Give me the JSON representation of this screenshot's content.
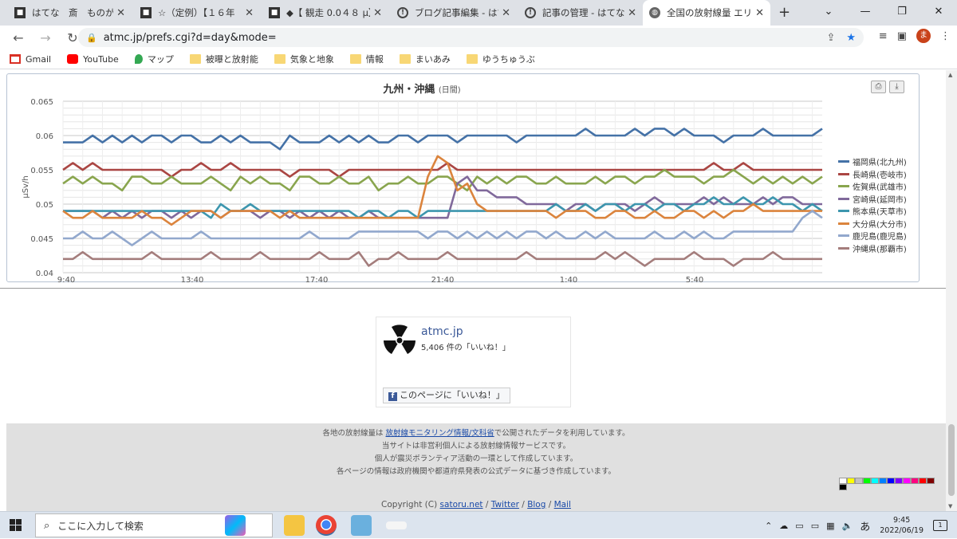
{
  "tabs": [
    {
      "label": "はてな　斎　ものが",
      "icon": "app-icon"
    },
    {
      "label": "☆（定例）【１６年",
      "icon": "app-icon"
    },
    {
      "label": "◆【 観走 0.0４８ μ】",
      "icon": "app-icon"
    },
    {
      "label": "ブログ記事編集 - はてな",
      "icon": "hatena-icon"
    },
    {
      "label": "記事の管理 - はてなブロ",
      "icon": "hatena-icon"
    },
    {
      "label": "全国の放射線量 エリア",
      "icon": "globe-icon"
    }
  ],
  "window_controls": {
    "minimize": "⌄",
    "min": "—",
    "restore": "❐",
    "close": "✕"
  },
  "address": {
    "url": "atmc.jp/prefs.cgi?d=day&mode=",
    "avatar_letter": "ま"
  },
  "bookmarks": [
    {
      "label": "Gmail",
      "icon": "gmail-icon"
    },
    {
      "label": "YouTube",
      "icon": "youtube-icon"
    },
    {
      "label": "マップ",
      "icon": "maps-icon"
    },
    {
      "label": "被曝と放射能",
      "icon": "folder-icon"
    },
    {
      "label": "気象と地象",
      "icon": "folder-icon"
    },
    {
      "label": "情報",
      "icon": "folder-icon"
    },
    {
      "label": "まいあみ",
      "icon": "folder-icon"
    },
    {
      "label": "ゆうちゅうぶ",
      "icon": "folder-icon"
    }
  ],
  "chart_data": {
    "type": "line",
    "title": "九州・沖縄",
    "subtitle": "(日間)",
    "ylabel": "μSv/h",
    "xlabel": "",
    "ylim": [
      0.04,
      0.065
    ],
    "yticks": [
      "0.065",
      "0.06",
      "0.055",
      "0.05",
      "0.045",
      "0.04"
    ],
    "xticks": [
      "9:40",
      "13:40",
      "17:40",
      "21:40",
      "1:40",
      "5:40"
    ],
    "grid": true,
    "legend_position": "right",
    "series": [
      {
        "name": "福岡県(北九州)",
        "color": "#4572a7",
        "values": [
          0.059,
          0.059,
          0.059,
          0.06,
          0.059,
          0.06,
          0.059,
          0.06,
          0.059,
          0.06,
          0.06,
          0.059,
          0.06,
          0.06,
          0.059,
          0.059,
          0.06,
          0.059,
          0.06,
          0.059,
          0.059,
          0.059,
          0.058,
          0.06,
          0.059,
          0.059,
          0.059,
          0.06,
          0.059,
          0.06,
          0.059,
          0.06,
          0.059,
          0.059,
          0.06,
          0.06,
          0.059,
          0.06,
          0.06,
          0.06,
          0.059,
          0.06,
          0.06,
          0.06,
          0.06,
          0.06,
          0.059,
          0.06,
          0.06,
          0.06,
          0.06,
          0.06,
          0.06,
          0.061,
          0.06,
          0.06,
          0.06,
          0.06,
          0.061,
          0.06,
          0.061,
          0.061,
          0.06,
          0.061,
          0.06,
          0.06,
          0.06,
          0.059,
          0.06,
          0.06,
          0.06,
          0.061,
          0.06,
          0.06,
          0.06,
          0.06,
          0.06,
          0.061
        ]
      },
      {
        "name": "長崎県(壱岐市)",
        "color": "#aa4643",
        "values": [
          0.055,
          0.056,
          0.055,
          0.056,
          0.055,
          0.055,
          0.055,
          0.055,
          0.055,
          0.055,
          0.055,
          0.054,
          0.055,
          0.055,
          0.056,
          0.055,
          0.055,
          0.056,
          0.055,
          0.055,
          0.055,
          0.055,
          0.055,
          0.054,
          0.055,
          0.055,
          0.055,
          0.055,
          0.054,
          0.055,
          0.055,
          0.055,
          0.055,
          0.055,
          0.055,
          0.055,
          0.055,
          0.055,
          0.055,
          0.056,
          0.055,
          0.055,
          0.055,
          0.055,
          0.055,
          0.055,
          0.055,
          0.055,
          0.055,
          0.055,
          0.055,
          0.055,
          0.055,
          0.055,
          0.055,
          0.055,
          0.055,
          0.055,
          0.055,
          0.055,
          0.055,
          0.055,
          0.055,
          0.055,
          0.055,
          0.055,
          0.056,
          0.055,
          0.055,
          0.056,
          0.055,
          0.055,
          0.055,
          0.055,
          0.055,
          0.055,
          0.055,
          0.055
        ]
      },
      {
        "name": "佐賀県(武雄市)",
        "color": "#89a54e",
        "values": [
          0.053,
          0.054,
          0.053,
          0.054,
          0.053,
          0.053,
          0.052,
          0.054,
          0.054,
          0.053,
          0.053,
          0.054,
          0.053,
          0.053,
          0.053,
          0.054,
          0.053,
          0.052,
          0.054,
          0.053,
          0.054,
          0.053,
          0.053,
          0.052,
          0.054,
          0.054,
          0.053,
          0.053,
          0.054,
          0.053,
          0.053,
          0.054,
          0.052,
          0.053,
          0.053,
          0.054,
          0.053,
          0.053,
          0.054,
          0.054,
          0.053,
          0.052,
          0.054,
          0.053,
          0.054,
          0.053,
          0.054,
          0.054,
          0.053,
          0.053,
          0.054,
          0.053,
          0.053,
          0.053,
          0.054,
          0.053,
          0.054,
          0.054,
          0.053,
          0.054,
          0.054,
          0.055,
          0.054,
          0.054,
          0.054,
          0.053,
          0.054,
          0.054,
          0.055,
          0.054,
          0.053,
          0.054,
          0.053,
          0.054,
          0.053,
          0.054,
          0.053,
          0.054
        ]
      },
      {
        "name": "宮崎県(延岡市)",
        "color": "#80699b",
        "values": [
          0.049,
          0.049,
          0.049,
          0.049,
          0.048,
          0.049,
          0.048,
          0.049,
          0.048,
          0.049,
          0.049,
          0.048,
          0.049,
          0.048,
          0.049,
          0.049,
          0.048,
          0.049,
          0.049,
          0.049,
          0.048,
          0.049,
          0.049,
          0.048,
          0.049,
          0.048,
          0.049,
          0.048,
          0.049,
          0.048,
          0.048,
          0.049,
          0.048,
          0.048,
          0.048,
          0.048,
          0.048,
          0.048,
          0.048,
          0.048,
          0.053,
          0.054,
          0.052,
          0.052,
          0.051,
          0.051,
          0.051,
          0.05,
          0.05,
          0.05,
          0.05,
          0.049,
          0.05,
          0.05,
          0.049,
          0.05,
          0.05,
          0.05,
          0.049,
          0.05,
          0.051,
          0.05,
          0.05,
          0.05,
          0.05,
          0.051,
          0.05,
          0.051,
          0.05,
          0.05,
          0.05,
          0.051,
          0.05,
          0.051,
          0.051,
          0.05,
          0.05,
          0.05
        ]
      },
      {
        "name": "熊本県(天草市)",
        "color": "#3d96ae",
        "values": [
          0.049,
          0.049,
          0.049,
          0.049,
          0.049,
          0.049,
          0.049,
          0.049,
          0.049,
          0.049,
          0.049,
          0.049,
          0.049,
          0.049,
          0.049,
          0.048,
          0.05,
          0.049,
          0.049,
          0.05,
          0.049,
          0.049,
          0.049,
          0.049,
          0.049,
          0.049,
          0.049,
          0.049,
          0.049,
          0.049,
          0.048,
          0.049,
          0.049,
          0.048,
          0.049,
          0.049,
          0.048,
          0.049,
          0.049,
          0.049,
          0.049,
          0.049,
          0.049,
          0.049,
          0.049,
          0.049,
          0.049,
          0.049,
          0.049,
          0.049,
          0.05,
          0.049,
          0.049,
          0.05,
          0.049,
          0.05,
          0.05,
          0.049,
          0.05,
          0.05,
          0.049,
          0.05,
          0.05,
          0.049,
          0.05,
          0.05,
          0.051,
          0.05,
          0.05,
          0.051,
          0.05,
          0.05,
          0.051,
          0.05,
          0.05,
          0.049,
          0.05,
          0.049
        ]
      },
      {
        "name": "大分県(大分市)",
        "color": "#db843d",
        "values": [
          0.049,
          0.048,
          0.048,
          0.049,
          0.048,
          0.048,
          0.048,
          0.048,
          0.049,
          0.048,
          0.048,
          0.047,
          0.048,
          0.049,
          0.049,
          0.049,
          0.048,
          0.049,
          0.049,
          0.049,
          0.049,
          0.049,
          0.048,
          0.049,
          0.048,
          0.048,
          0.048,
          0.048,
          0.048,
          0.048,
          0.048,
          0.048,
          0.048,
          0.048,
          0.048,
          0.048,
          0.048,
          0.054,
          0.057,
          0.056,
          0.052,
          0.053,
          0.05,
          0.049,
          0.049,
          0.049,
          0.049,
          0.049,
          0.049,
          0.049,
          0.048,
          0.049,
          0.049,
          0.049,
          0.048,
          0.048,
          0.049,
          0.049,
          0.048,
          0.048,
          0.049,
          0.048,
          0.048,
          0.049,
          0.049,
          0.048,
          0.049,
          0.048,
          0.049,
          0.049,
          0.05,
          0.049,
          0.049,
          0.049,
          0.049,
          0.049,
          0.049,
          0.049
        ]
      },
      {
        "name": "鹿児島(鹿児島)",
        "color": "#92a8cd",
        "values": [
          0.045,
          0.045,
          0.046,
          0.045,
          0.045,
          0.046,
          0.045,
          0.044,
          0.045,
          0.046,
          0.045,
          0.045,
          0.045,
          0.045,
          0.046,
          0.045,
          0.045,
          0.045,
          0.045,
          0.045,
          0.045,
          0.045,
          0.045,
          0.045,
          0.045,
          0.046,
          0.045,
          0.045,
          0.045,
          0.045,
          0.046,
          0.046,
          0.046,
          0.046,
          0.046,
          0.046,
          0.046,
          0.045,
          0.046,
          0.046,
          0.045,
          0.046,
          0.045,
          0.046,
          0.045,
          0.046,
          0.045,
          0.046,
          0.046,
          0.045,
          0.046,
          0.045,
          0.045,
          0.046,
          0.045,
          0.046,
          0.045,
          0.045,
          0.045,
          0.045,
          0.046,
          0.045,
          0.045,
          0.046,
          0.045,
          0.046,
          0.045,
          0.045,
          0.046,
          0.046,
          0.046,
          0.046,
          0.046,
          0.046,
          0.046,
          0.048,
          0.049,
          0.048
        ]
      },
      {
        "name": "沖縄県(那覇市)",
        "color": "#a47d7c",
        "values": [
          0.042,
          0.042,
          0.043,
          0.042,
          0.042,
          0.042,
          0.042,
          0.042,
          0.042,
          0.043,
          0.042,
          0.042,
          0.042,
          0.042,
          0.042,
          0.043,
          0.042,
          0.042,
          0.042,
          0.042,
          0.043,
          0.042,
          0.042,
          0.042,
          0.042,
          0.042,
          0.043,
          0.042,
          0.042,
          0.042,
          0.043,
          0.041,
          0.042,
          0.042,
          0.043,
          0.042,
          0.042,
          0.042,
          0.042,
          0.043,
          0.042,
          0.042,
          0.042,
          0.042,
          0.042,
          0.042,
          0.042,
          0.043,
          0.042,
          0.042,
          0.042,
          0.042,
          0.042,
          0.042,
          0.042,
          0.043,
          0.042,
          0.043,
          0.042,
          0.041,
          0.042,
          0.042,
          0.042,
          0.042,
          0.043,
          0.042,
          0.042,
          0.042,
          0.041,
          0.042,
          0.042,
          0.042,
          0.043,
          0.042,
          0.042,
          0.042,
          0.042,
          0.042
        ]
      }
    ]
  },
  "fb_widget": {
    "name": "atmc.jp",
    "likes": "5,406 件の「いいね！」",
    "button": "このページに「いいね！」"
  },
  "footer": {
    "line1_pre": "各地の放射線量は ",
    "line1_link": "放射線モニタリング情報/文科省",
    "line1_post": "で公開されたデータを利用しています。",
    "line2": "当サイトは非営利個人による放射線情報サービスです。",
    "line3": "個人が震災ボランティア活動の一環として作成しています。",
    "line4": "各ページの情報は政府機関や都道府県発表の公式データに基づき作成しています。",
    "copyright_pre": "Copyright (C) ",
    "copyright_link1": "satoru.net",
    "copyright_link2": "Twitter",
    "copyright_link3": "Blog",
    "copyright_link4": "Mail",
    "sep": " / "
  },
  "palette": [
    "#ffffff",
    "#ffff00",
    "#c0c0c0",
    "#00ff00",
    "#00ffff",
    "#0080ff",
    "#0000ff",
    "#8000ff",
    "#ff00ff",
    "#ff0080",
    "#ff0000",
    "#800000",
    "#000000"
  ],
  "taskbar": {
    "search_placeholder": "ここに入力して検索",
    "time": "9:45",
    "date": "2022/06/19",
    "ime": "あ",
    "notif_count": "1"
  }
}
